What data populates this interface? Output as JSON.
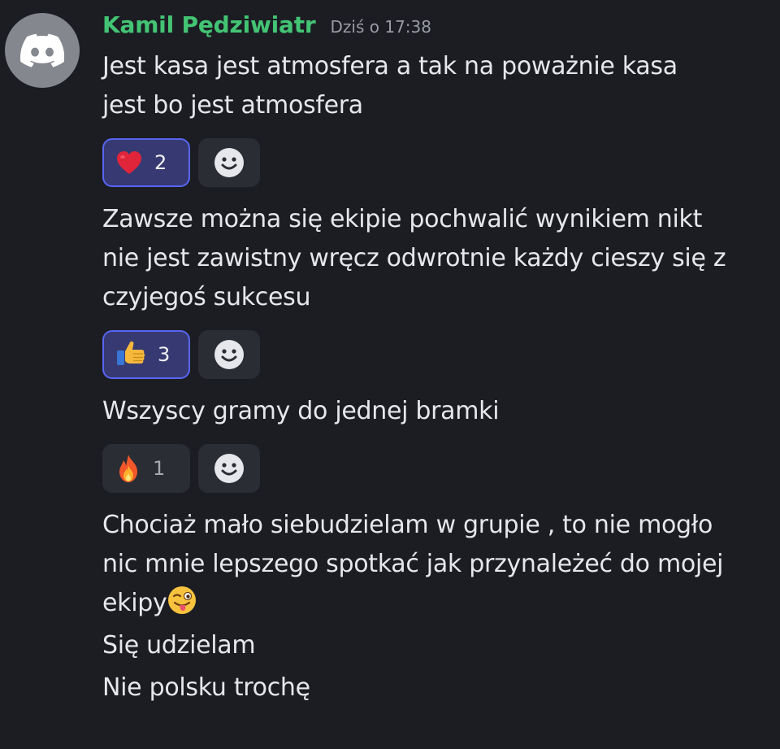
{
  "author": {
    "name": "Kamil Pędziwiatr",
    "name_color": "#43c474",
    "timestamp": "Dziś o 17:38",
    "avatar_icon": "discord-logo-icon"
  },
  "messages": [
    {
      "text": "Jest kasa jest atmosfera a tak na poważnie kasa\njest bo jest atmosfera",
      "reactions": [
        {
          "emoji": "heart-emoji",
          "count": "2",
          "active": true
        }
      ]
    },
    {
      "text": "Zawsze można się ekipie pochwalić wynikiem nikt\nnie jest zawistny wręcz odwrotnie każdy cieszy się z\nczyjegoś sukcesu",
      "reactions": [
        {
          "emoji": "thumbs-up-emoji",
          "count": "3",
          "active": true
        }
      ]
    },
    {
      "text": "Wszyscy gramy do jednej bramki",
      "reactions": [
        {
          "emoji": "fire-emoji",
          "count": "1",
          "active": false
        }
      ]
    },
    {
      "text": "Chociaż mało siebudzielam w grupie , to nie mogło\nnic mnie lepszego spotkać jak przynależeć do mojej\nekipy",
      "trailing_emoji": "winking-tongue-emoji"
    },
    {
      "text": "Się udzielam"
    },
    {
      "text": "Nie polsku trochę"
    }
  ],
  "colors": {
    "background": "#1c1d23",
    "reaction_active_bg": "#373a72",
    "reaction_active_border": "#5865f2",
    "reaction_bg": "#2b2d35"
  },
  "add_reaction_icon": "smiley-add-reaction-icon"
}
